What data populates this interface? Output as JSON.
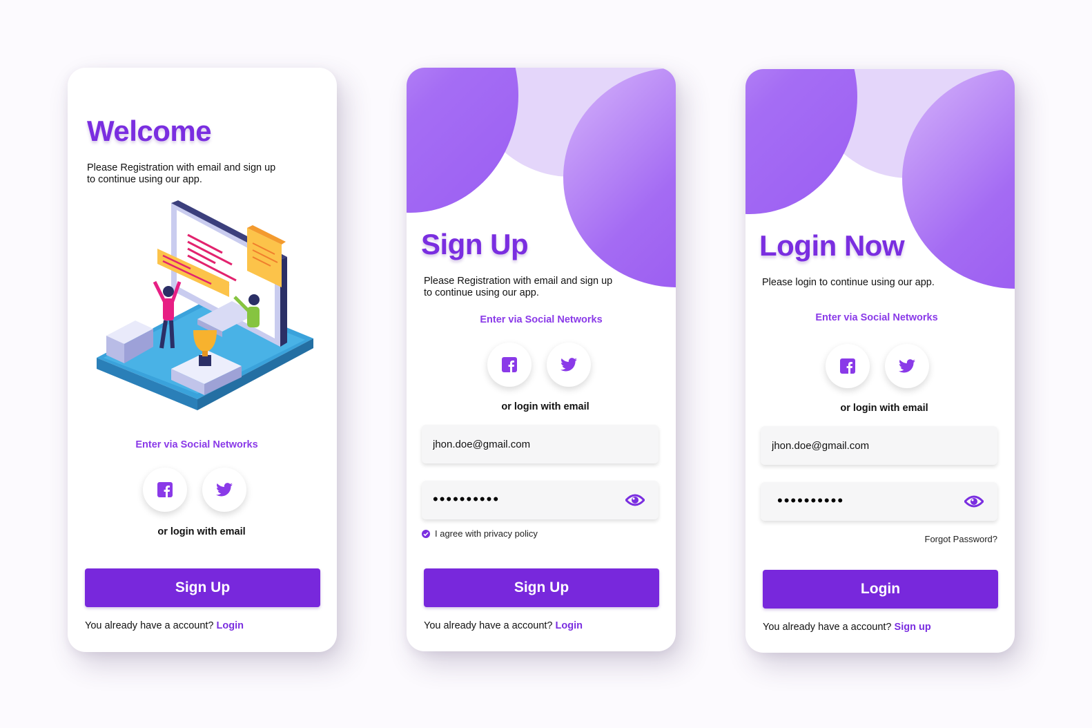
{
  "welcome": {
    "title": "Welcome",
    "desc_line1": "Please Registration with email and sign up",
    "desc_line2": "to continue using our app.",
    "social_title": "Enter via Social Networks",
    "or_text": "or login with email",
    "primary_button": "Sign Up",
    "footer_text": "You already have a account? ",
    "footer_link": "Login"
  },
  "signup": {
    "title": "Sign Up",
    "desc_line1": "Please Registration with email and sign up",
    "desc_line2": "to continue using our app.",
    "social_title": "Enter via Social Networks",
    "or_text": "or login with email",
    "email_value": "jhon.doe@gmail.com",
    "password_mask": "••••••••••",
    "agree_text": "I agree with privacy policy",
    "agree_checked": true,
    "primary_button": "Sign Up",
    "footer_text": "You already have a account? ",
    "footer_link": "Login"
  },
  "login": {
    "title": "Login Now",
    "desc": "Please login to continue using our app.",
    "social_title": "Enter via Social Networks",
    "or_text": "or login with email",
    "email_value": "jhon.doe@gmail.com",
    "password_mask": "••••••••••",
    "forgot_text": "Forgot Password?",
    "primary_button": "Login",
    "footer_text": "You already have a account? ",
    "footer_link": "Sign up"
  },
  "colors": {
    "accent": "#7828dc",
    "accent_text": "#7a2ee0",
    "social_title": "#8a3ae8",
    "circle_light": "#e4d6fa",
    "field_bg": "#f6f6f7"
  },
  "icons": [
    "facebook-icon",
    "twitter-icon",
    "eye-icon",
    "check-icon"
  ]
}
